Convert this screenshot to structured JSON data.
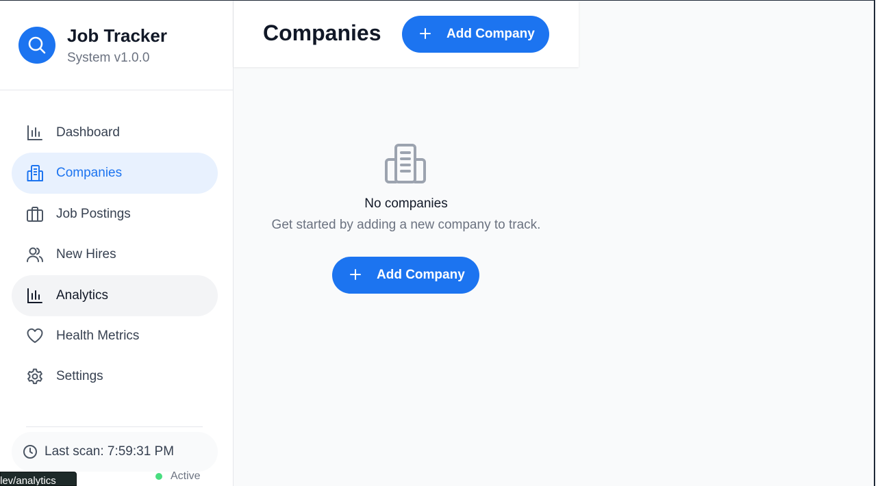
{
  "app": {
    "title": "Job Tracker",
    "version": "System v1.0.0",
    "accent_color": "#1c74f0"
  },
  "sidebar": {
    "items": [
      {
        "label": "Dashboard",
        "icon": "bar-chart-icon",
        "state": "default"
      },
      {
        "label": "Companies",
        "icon": "building-icon",
        "state": "active"
      },
      {
        "label": "Job Postings",
        "icon": "briefcase-icon",
        "state": "default"
      },
      {
        "label": "New Hires",
        "icon": "users-icon",
        "state": "default"
      },
      {
        "label": "Analytics",
        "icon": "bar-chart-icon",
        "state": "hover"
      },
      {
        "label": "Health Metrics",
        "icon": "heart-icon",
        "state": "default"
      },
      {
        "label": "Settings",
        "icon": "gear-icon",
        "state": "default"
      }
    ],
    "last_scan": "Last scan: 7:59:31 PM",
    "status": "Active",
    "status_color": "#4ade80"
  },
  "header": {
    "title": "Companies",
    "add_button_label": "Add Company"
  },
  "empty_state": {
    "title": "No companies",
    "description": "Get started by adding a new company to track.",
    "button_label": "Add Company",
    "icon": "building-icon"
  },
  "tooltip": {
    "url": "dev/analytics"
  }
}
